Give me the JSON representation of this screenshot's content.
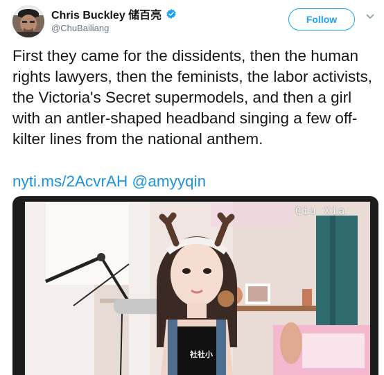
{
  "author": {
    "display_name": "Chris Buckley 储百亮",
    "handle": "@ChuBailiang",
    "verified": true,
    "avatar_icon": "profile-photo"
  },
  "actions": {
    "follow_label": "Follow"
  },
  "tweet": {
    "text": "First they came for the dissidents, then the human rights lawyers, then the feminists, the labor activists, the Victoria's Secret supermodels, and then a girl with an antler-shaped headband singing a few off-kilter lines from the national anthem.",
    "link1": "nyti.ms/2AcvrAH",
    "link2": "@amyyqin"
  },
  "media": {
    "overlay_title": "Qiu Xia",
    "shirt_text": "社社小"
  },
  "colors": {
    "accent": "#1da1f2",
    "link": "#1b95e0",
    "text": "#14171a",
    "secondary": "#657786"
  }
}
